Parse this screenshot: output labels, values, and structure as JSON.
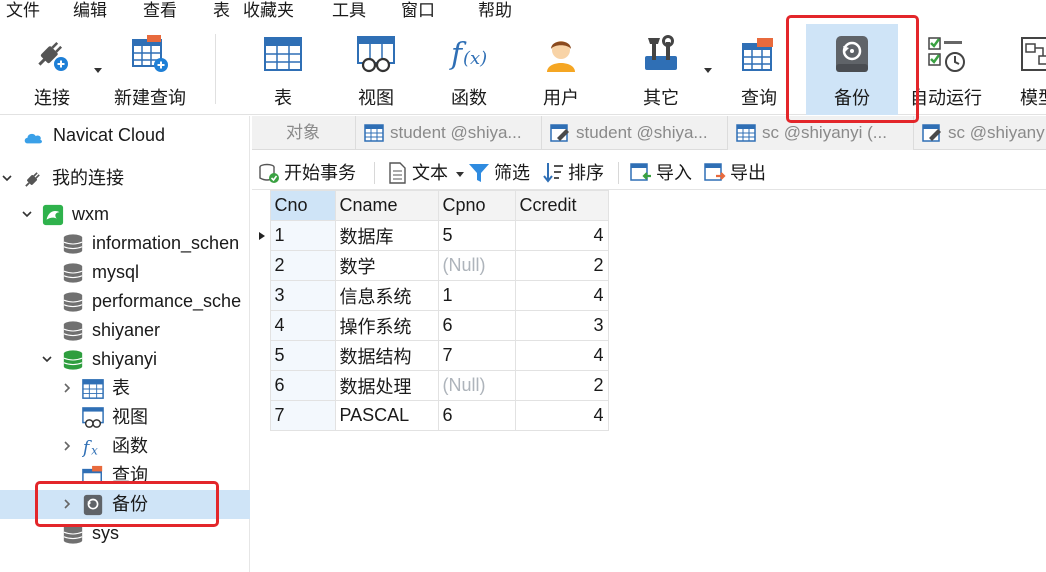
{
  "menu": {
    "items": [
      {
        "label": "文件"
      },
      {
        "label": "编辑"
      },
      {
        "label": "查看"
      },
      {
        "label": "表"
      },
      {
        "label": "收藏夹"
      },
      {
        "label": "工具"
      },
      {
        "label": "窗口"
      },
      {
        "label": "帮助"
      }
    ]
  },
  "toolbar": {
    "items": [
      {
        "label": "连接",
        "icon": "plug-icon"
      },
      {
        "label": "新建查询",
        "icon": "new-query-icon"
      },
      {
        "label": "表",
        "icon": "table-icon"
      },
      {
        "label": "视图",
        "icon": "view-icon"
      },
      {
        "label": "函数",
        "icon": "function-icon"
      },
      {
        "label": "用户",
        "icon": "user-icon"
      },
      {
        "label": "其它",
        "icon": "tools-icon"
      },
      {
        "label": "查询",
        "icon": "query-icon"
      },
      {
        "label": "备份",
        "icon": "backup-icon"
      },
      {
        "label": "自动运行",
        "icon": "schedule-icon"
      },
      {
        "label": "模型",
        "icon": "model-icon"
      }
    ],
    "active": "备份"
  },
  "nav": {
    "cloud": "Navicat Cloud",
    "my_connections": "我的连接",
    "connection": "wxm",
    "databases": {
      "information_schema": "information_schen",
      "mysql": "mysql",
      "performance_schema": "performance_sche",
      "shiyaner": "shiyaner",
      "shiyanyi": "shiyanyi",
      "sys": "sys"
    },
    "children": {
      "tables": "表",
      "views": "视图",
      "functions": "函数",
      "queries": "查询",
      "backups": "备份"
    }
  },
  "tabs": [
    {
      "label": "对象"
    },
    {
      "label": "student @shiya...",
      "icon": "table-icon"
    },
    {
      "label": "student @shiya...",
      "icon": "design-table-icon"
    },
    {
      "label": "sc @shiyanyi (...",
      "icon": "table-icon"
    },
    {
      "label": "sc @shiyany",
      "icon": "design-table-icon"
    }
  ],
  "subbar": {
    "begin_transaction": "开始事务",
    "text": "文本",
    "filter": "筛选",
    "sort": "排序",
    "import": "导入",
    "export": "导出"
  },
  "grid": {
    "columns": [
      "Cno",
      "Cname",
      "Cpno",
      "Ccredit"
    ],
    "null_text": "(Null)",
    "rows": [
      {
        "Cno": "1",
        "Cname": "数据库",
        "Cpno": "5",
        "Ccredit": "4",
        "current": true
      },
      {
        "Cno": "2",
        "Cname": "数学",
        "Cpno": null,
        "Ccredit": "2"
      },
      {
        "Cno": "3",
        "Cname": "信息系统",
        "Cpno": "1",
        "Ccredit": "4"
      },
      {
        "Cno": "4",
        "Cname": "操作系统",
        "Cpno": "6",
        "Ccredit": "3"
      },
      {
        "Cno": "5",
        "Cname": "数据结构",
        "Cpno": "7",
        "Ccredit": "4"
      },
      {
        "Cno": "6",
        "Cname": "数据处理",
        "Cpno": null,
        "Ccredit": "2"
      },
      {
        "Cno": "7",
        "Cname": "PASCAL",
        "Cpno": "6",
        "Ccredit": "4"
      }
    ]
  },
  "colors": {
    "selection": "#cfe4f7",
    "annotation_red": "#e3262a",
    "null_text": "#aeb4bb"
  }
}
